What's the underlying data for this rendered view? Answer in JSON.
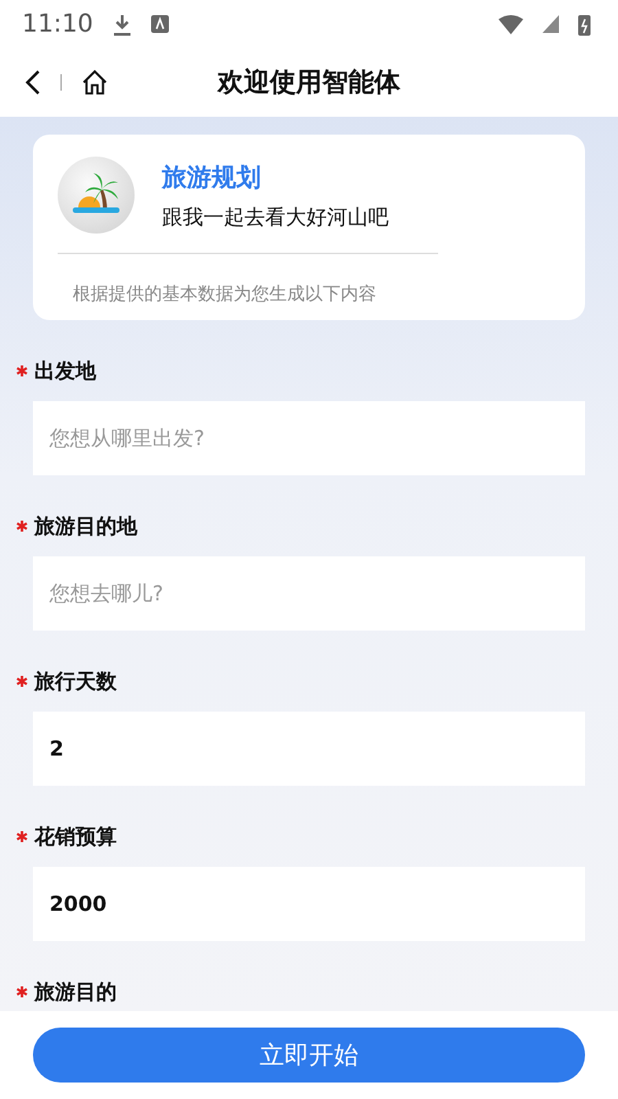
{
  "status_bar": {
    "time": "11:10"
  },
  "header": {
    "title": "欢迎使用智能体"
  },
  "agent_card": {
    "name": "旅游规划",
    "tagline": "跟我一起去看大好河山吧",
    "note": "根据提供的基本数据为您生成以下内容"
  },
  "fields": [
    {
      "label": "出发地",
      "required": true,
      "placeholder": "您想从哪里出发?"
    },
    {
      "label": "旅游目的地",
      "required": true,
      "placeholder": "您想去哪儿?"
    },
    {
      "label": "旅行天数",
      "required": true,
      "value": "2"
    },
    {
      "label": "花销预算",
      "required": true,
      "value": "2000"
    },
    {
      "label": "旅游目的",
      "required": true
    }
  ],
  "start_button": "立即开始"
}
